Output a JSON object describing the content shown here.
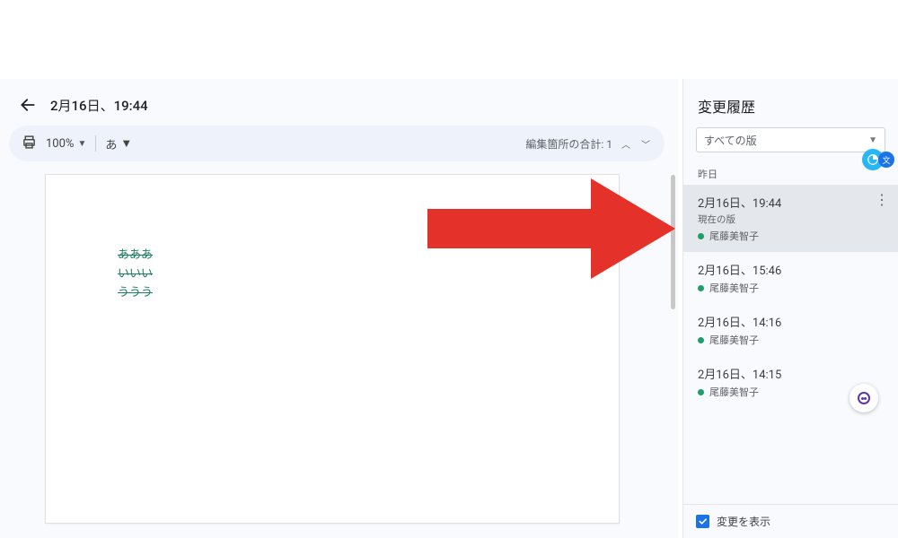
{
  "header": {
    "title": "2月16日、19:44"
  },
  "toolbar": {
    "zoom": "100%",
    "lang_toggle": "あ",
    "edits_label": "編集箇所の合計: 1"
  },
  "document": {
    "lines": [
      "あああ",
      "いいい",
      "ううう"
    ]
  },
  "sidebar": {
    "title": "変更履歴",
    "filter_label": "すべての版",
    "section_label": "昨日",
    "show_changes_label": "変更を表示"
  },
  "versions": [
    {
      "time": "2月16日、19:44",
      "subtitle": "現在の版",
      "author": "尾藤美智子",
      "selected": true
    },
    {
      "time": "2月16日、15:46",
      "subtitle": "",
      "author": "尾藤美智子",
      "selected": false
    },
    {
      "time": "2月16日、14:16",
      "subtitle": "",
      "author": "尾藤美智子",
      "selected": false
    },
    {
      "time": "2月16日、14:15",
      "subtitle": "",
      "author": "尾藤美智子",
      "selected": false
    }
  ],
  "colors": {
    "accent_green": "#1e9e6a",
    "arrow_red": "#e4322b",
    "checkbox_blue": "#1a73e8"
  }
}
